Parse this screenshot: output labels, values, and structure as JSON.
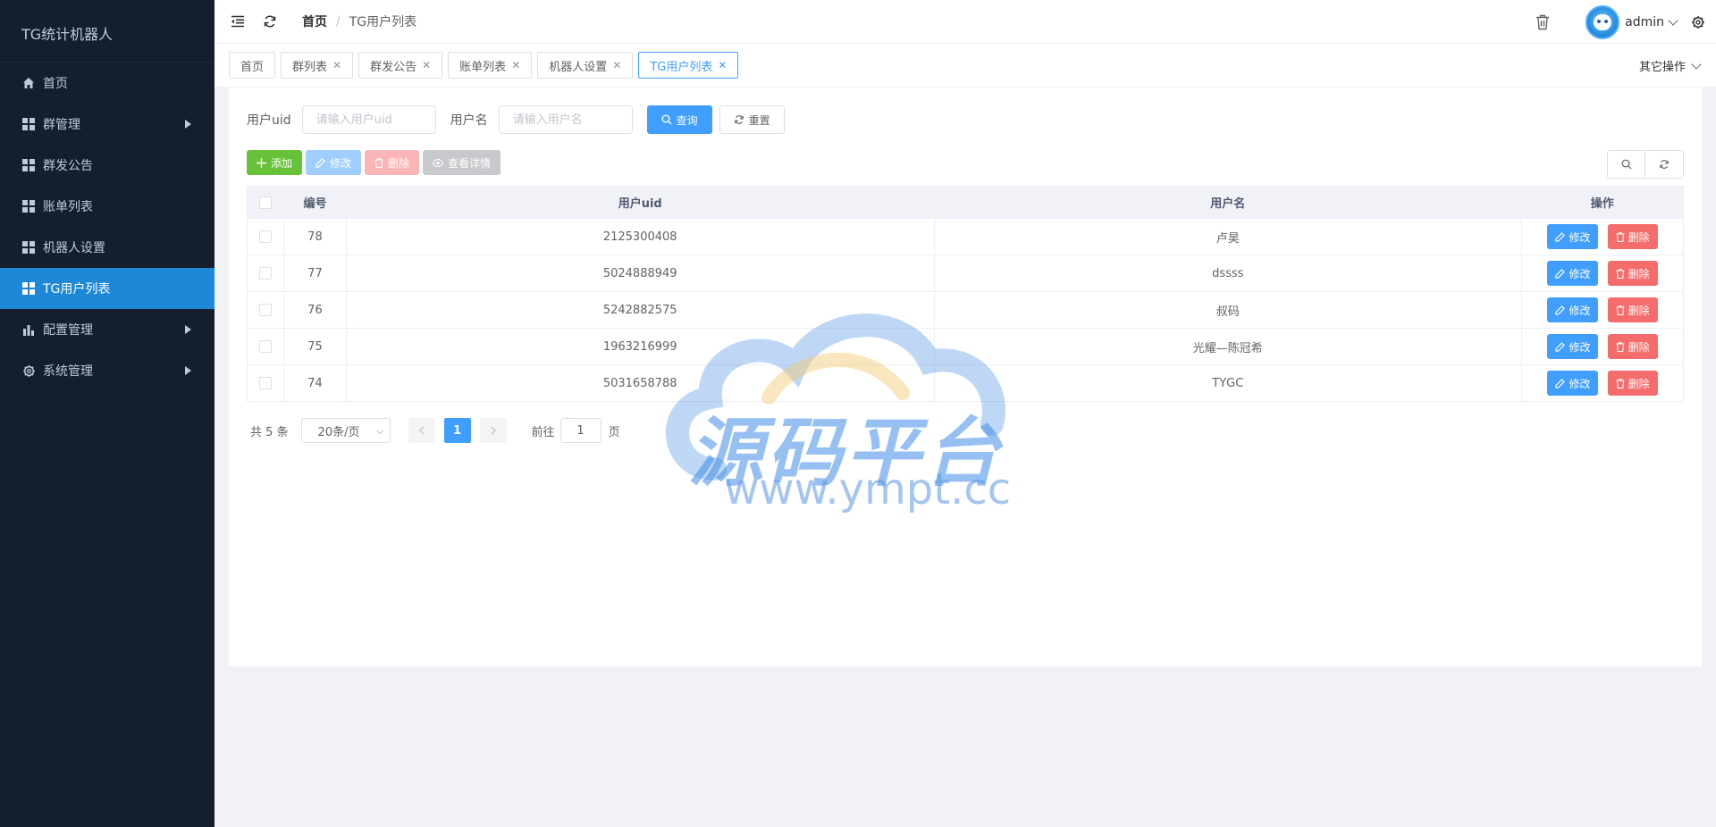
{
  "app": {
    "title": "TG统计机器人"
  },
  "sidebar": {
    "items": [
      {
        "label": "首页",
        "icon": "home-icon",
        "has_children": false,
        "active": false
      },
      {
        "label": "群管理",
        "icon": "grid-icon",
        "has_children": true,
        "active": false
      },
      {
        "label": "群发公告",
        "icon": "grid-icon",
        "has_children": false,
        "active": false
      },
      {
        "label": "账单列表",
        "icon": "grid-icon",
        "has_children": false,
        "active": false
      },
      {
        "label": "机器人设置",
        "icon": "grid-icon",
        "has_children": false,
        "active": false
      },
      {
        "label": "TG用户列表",
        "icon": "grid-icon",
        "has_children": false,
        "active": true
      },
      {
        "label": "配置管理",
        "icon": "bar-chart-icon",
        "has_children": true,
        "active": false
      },
      {
        "label": "系统管理",
        "icon": "gear-icon",
        "has_children": true,
        "active": false
      }
    ]
  },
  "header": {
    "breadcrumb": {
      "home": "首页",
      "separator": "/",
      "current": "TG用户列表"
    },
    "user": {
      "name": "admin"
    }
  },
  "tags": {
    "items": [
      {
        "label": "首页",
        "closable": false,
        "active": false
      },
      {
        "label": "群列表",
        "closable": true,
        "active": false
      },
      {
        "label": "群发公告",
        "closable": true,
        "active": false
      },
      {
        "label": "账单列表",
        "closable": true,
        "active": false
      },
      {
        "label": "机器人设置",
        "closable": true,
        "active": false
      },
      {
        "label": "TG用户列表",
        "closable": true,
        "active": true
      }
    ],
    "other_ops": "其它操作"
  },
  "search": {
    "uid_label": "用户uid",
    "uid_placeholder": "请输入用户uid",
    "name_label": "用户名",
    "name_placeholder": "请输入用户名",
    "query_label": "查询",
    "reset_label": "重置"
  },
  "toolbar": {
    "add_label": "添加",
    "edit_label": "修改",
    "delete_label": "删除",
    "detail_label": "查看详情"
  },
  "table": {
    "columns": [
      "编号",
      "用户uid",
      "用户名",
      "操作"
    ],
    "rows": [
      {
        "id": "78",
        "uid": "2125300408",
        "name": "卢昊"
      },
      {
        "id": "77",
        "uid": "5024888949",
        "name": "dssss"
      },
      {
        "id": "76",
        "uid": "5242882575",
        "name": "叔码"
      },
      {
        "id": "75",
        "uid": "1963216999",
        "name": "光耀—陈冠希"
      },
      {
        "id": "74",
        "uid": "5031658788",
        "name": "TYGC"
      }
    ],
    "row_edit_label": "修改",
    "row_delete_label": "删除"
  },
  "pagination": {
    "total_text": "共 5 条",
    "page_size": "20条/页",
    "current_page": "1",
    "goto_label": "前往",
    "goto_value": "1",
    "page_unit": "页"
  },
  "watermark": {
    "title": "源码平台",
    "url": "www.ympt.cc"
  },
  "colors": {
    "sidebar_bg": "#141e2e",
    "active_menu": "#1e88d7",
    "primary": "#409eff",
    "success": "#67c23a",
    "danger": "#f56c6c"
  }
}
